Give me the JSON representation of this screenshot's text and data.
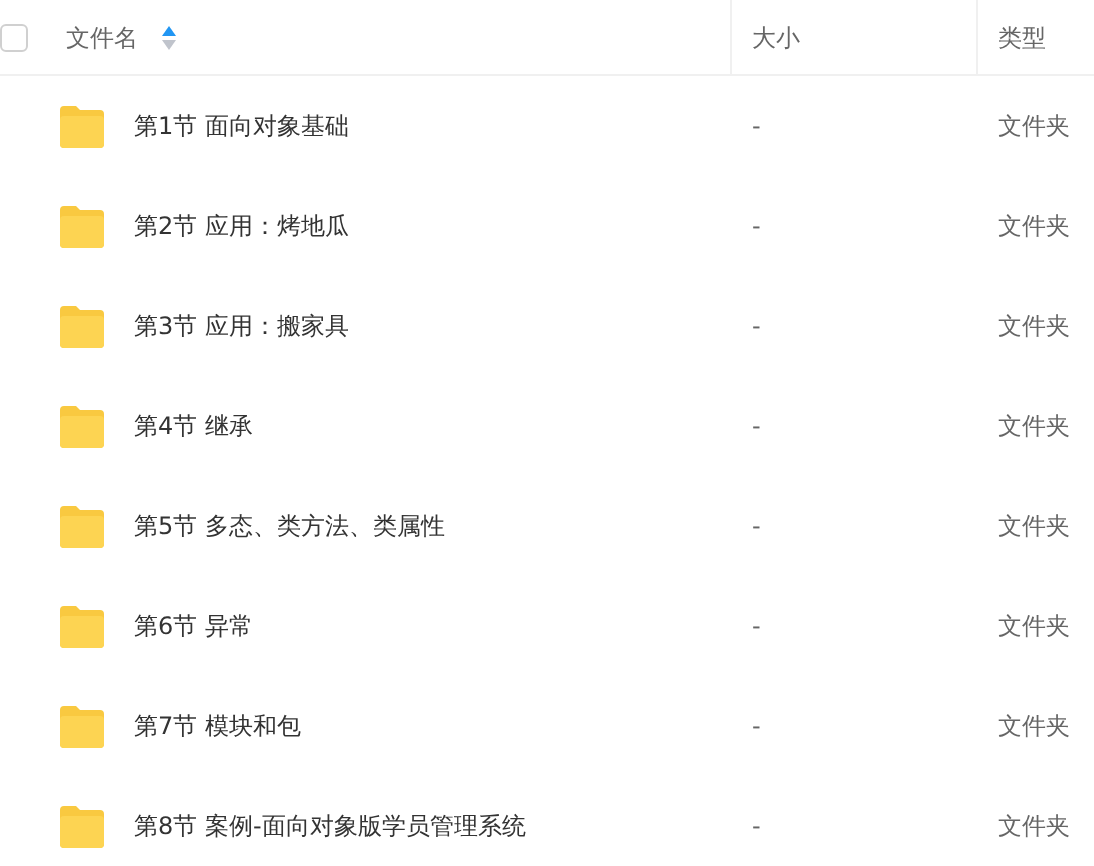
{
  "table": {
    "select_all": {
      "checked": false
    },
    "columns": [
      {
        "label": "文件名",
        "sort_ascending": true
      },
      {
        "label": "大小"
      },
      {
        "label": "类型"
      }
    ],
    "rows": [
      {
        "name": "第1节 面向对象基础",
        "size": "-",
        "type": "文件夹"
      },
      {
        "name": "第2节 应用：烤地瓜",
        "size": "-",
        "type": "文件夹"
      },
      {
        "name": "第3节 应用：搬家具",
        "size": "-",
        "type": "文件夹"
      },
      {
        "name": "第4节 继承",
        "size": "-",
        "type": "文件夹"
      },
      {
        "name": "第5节 多态、类方法、类属性",
        "size": "-",
        "type": "文件夹"
      },
      {
        "name": "第6节 异常",
        "size": "-",
        "type": "文件夹"
      },
      {
        "name": "第7节 模块和包",
        "size": "-",
        "type": "文件夹"
      },
      {
        "name": "第8节 案例-面向对象版学员管理系统",
        "size": "-",
        "type": "文件夹"
      }
    ]
  }
}
